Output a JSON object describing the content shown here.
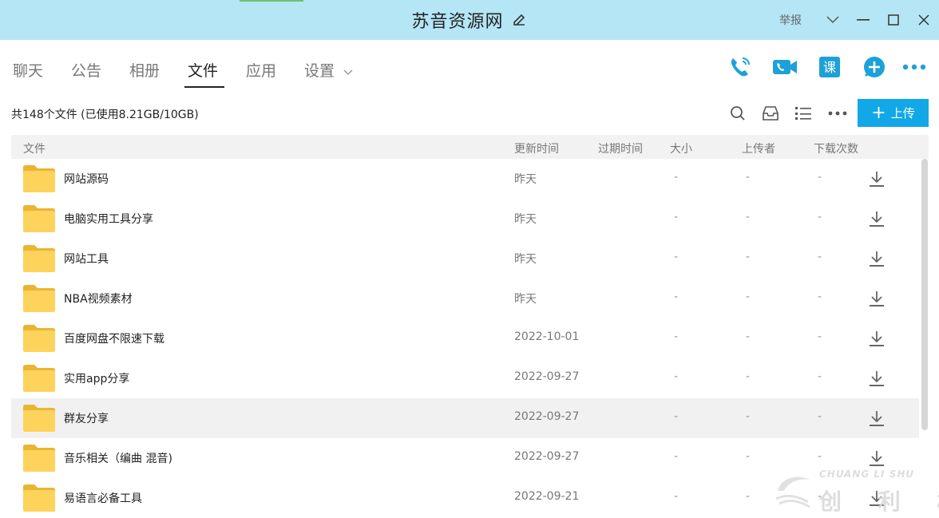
{
  "window": {
    "title": "苏音资源网",
    "report_label": "举报"
  },
  "tabs": [
    {
      "label": "聊天"
    },
    {
      "label": "公告"
    },
    {
      "label": "相册"
    },
    {
      "label": "文件",
      "active": true
    },
    {
      "label": "应用"
    },
    {
      "label": "设置"
    }
  ],
  "top_icons": [
    "phone-icon",
    "video-icon",
    "class-icon",
    "add-icon",
    "more-icon"
  ],
  "toolbar": {
    "summary": "共148个文件 (已使用8.21GB/10GB)",
    "upload_label": "上传"
  },
  "columns": [
    "文件",
    "更新时间",
    "过期时间",
    "大小",
    "上传者",
    "下载次数"
  ],
  "files": [
    {
      "name": "网站源码",
      "updated": "昨天",
      "expires": "-",
      "size": "-",
      "uploader": "-"
    },
    {
      "name": "电脑实用工具分享",
      "updated": "昨天",
      "expires": "-",
      "size": "-",
      "uploader": "-"
    },
    {
      "name": "网站工具",
      "updated": "昨天",
      "expires": "-",
      "size": "-",
      "uploader": "-"
    },
    {
      "name": "NBA视频素材",
      "updated": "昨天",
      "expires": "-",
      "size": "-",
      "uploader": "-"
    },
    {
      "name": "百度网盘不限速下载",
      "updated": "2022-10-01",
      "expires": "-",
      "size": "-",
      "uploader": "-"
    },
    {
      "name": "实用app分享",
      "updated": "2022-09-27",
      "expires": "-",
      "size": "-",
      "uploader": "-"
    },
    {
      "name": "群友分享",
      "updated": "2022-09-27",
      "expires": "-",
      "size": "-",
      "uploader": "-",
      "highlighted": true
    },
    {
      "name": "音乐相关（编曲 混音)",
      "updated": "2022-09-27",
      "expires": "-",
      "size": "-",
      "uploader": "-"
    },
    {
      "name": "易语言必备工具",
      "updated": "2022-09-21",
      "expires": "-",
      "size": "-",
      "uploader": "-"
    }
  ],
  "watermark": {
    "latin": "CHUANG LI SHU",
    "cn": "创 利 树"
  },
  "colors": {
    "titlebar": "#b4e6f6",
    "accent": "#12a8e8",
    "folder": "#fdd35c",
    "icon_blue": "#1da1d8"
  }
}
